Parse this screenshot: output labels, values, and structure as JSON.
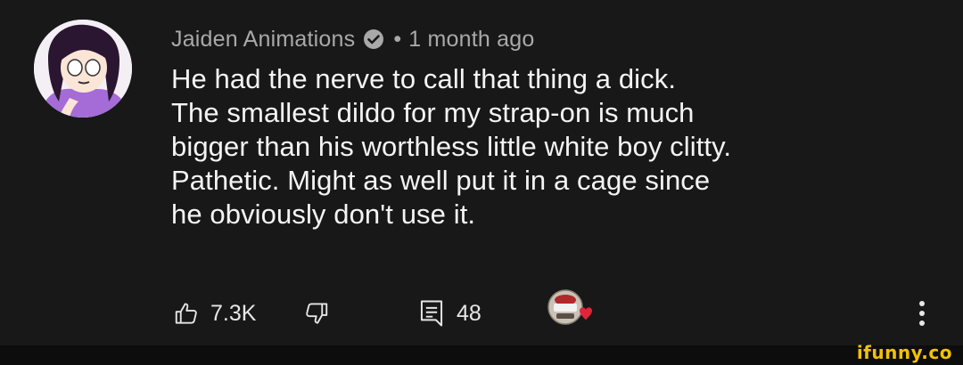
{
  "comment": {
    "author": "Jaiden Animations",
    "separator": "•",
    "timestamp": "1 month ago",
    "lines": [
      "He had the nerve to call that thing a dick.",
      "The smallest dildo for my strap-on is much",
      "bigger than his worthless little white boy clitty.",
      "Pathetic. Might as well put it in a cage since",
      "he obviously don't use it."
    ]
  },
  "actions": {
    "like_count": "7.3K",
    "reply_count": "48",
    "hearted_by": "creator-avatar-with-heart"
  },
  "icons": {
    "verified": "verified-check-icon",
    "like": "thumbs-up-icon",
    "dislike": "thumbs-down-icon",
    "reply": "reply-comment-icon",
    "more": "more-vertical-icon",
    "heart_color": "#e0243a"
  },
  "watermark": "ifunny.co",
  "colors": {
    "background": "#181818",
    "text": "#f4f4f4",
    "meta": "#a9a9a9",
    "watermark": "#f2c200"
  }
}
